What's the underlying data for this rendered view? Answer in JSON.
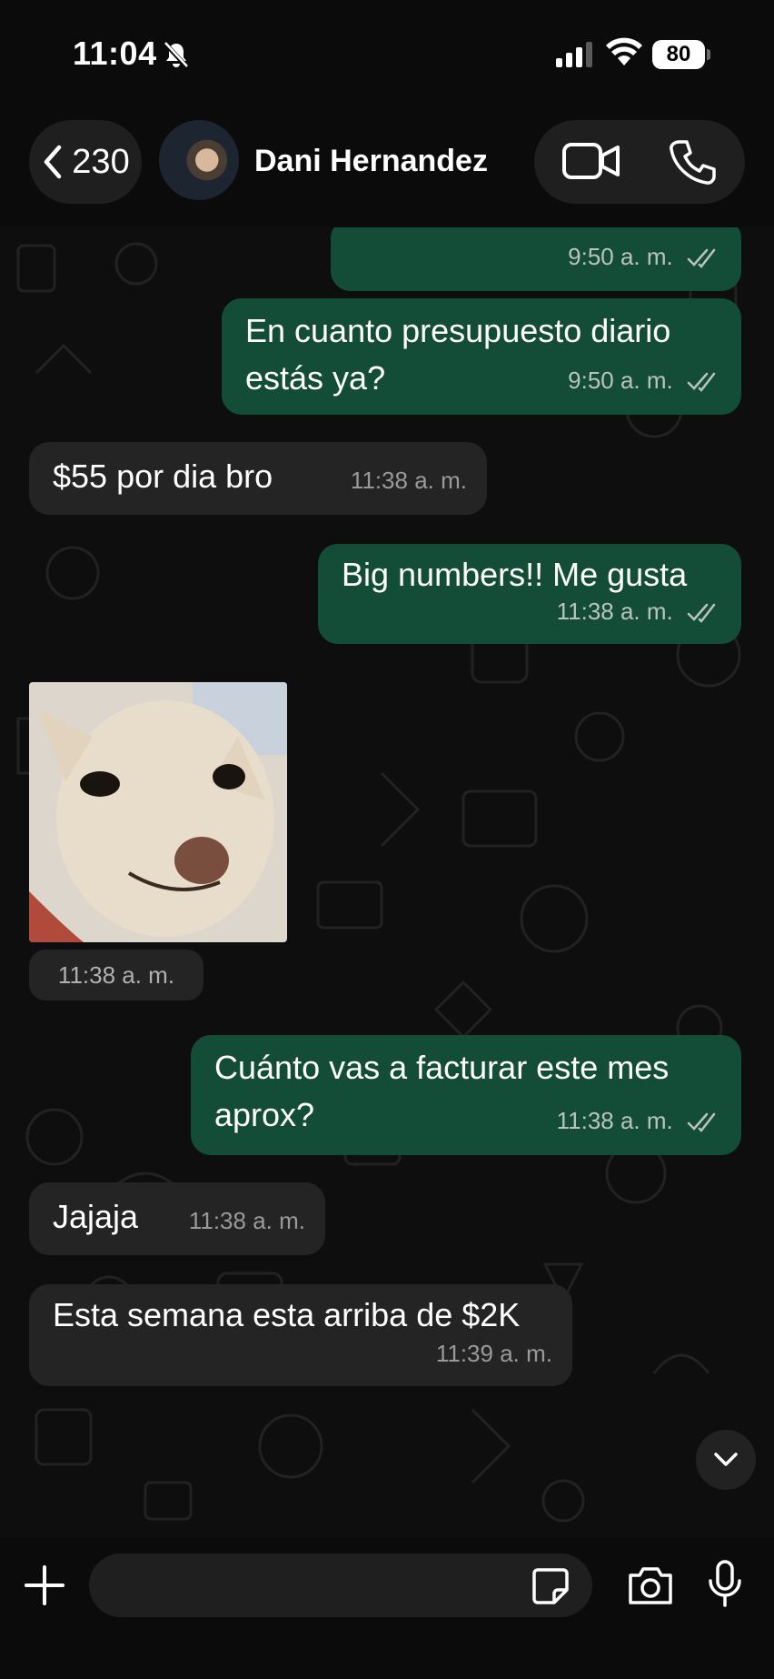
{
  "status_bar": {
    "time": "11:04",
    "battery": "80"
  },
  "header": {
    "back_count": "230",
    "contact_name": "Dani Hernandez"
  },
  "messages": [
    {
      "dir": "out",
      "text": "",
      "time": "9:50 a. m."
    },
    {
      "dir": "out",
      "text": "En cuanto presupuesto diario estás ya?",
      "time": "9:50 a. m."
    },
    {
      "dir": "in",
      "text": "$55 por dia bro",
      "time": "11:38 a. m."
    },
    {
      "dir": "out",
      "text": "Big numbers!! Me gusta",
      "time": "11:38 a. m."
    },
    {
      "dir": "in",
      "type": "image",
      "time": "11:38 a. m."
    },
    {
      "dir": "out",
      "text": "Cuánto vas a facturar este mes aprox?",
      "time": "11:38 a. m."
    },
    {
      "dir": "in",
      "text": "Jajaja",
      "time": "11:38 a. m."
    },
    {
      "dir": "in",
      "text": "Esta semana esta arriba de $2K",
      "time": "11:39 a. m."
    }
  ],
  "composer": {
    "placeholder": ""
  },
  "colors": {
    "outgoing_bubble": "#144d37",
    "incoming_bubble": "#242424",
    "background": "#0b0b0b"
  }
}
